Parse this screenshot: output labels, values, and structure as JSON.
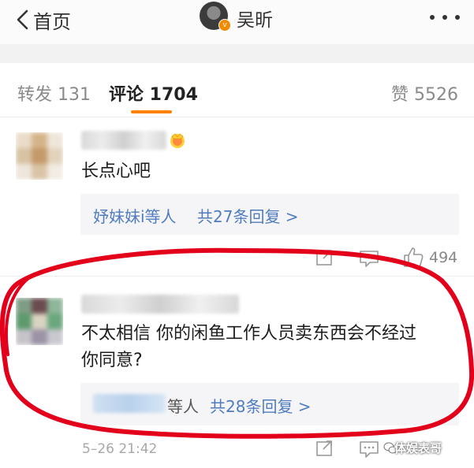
{
  "header": {
    "back_label": "首页",
    "title": "吴昕",
    "verified_badge": "v"
  },
  "tabs": [
    {
      "label": "转发 131"
    },
    {
      "label": "评论 1704"
    },
    {
      "label": "赞 5526"
    }
  ],
  "comments": [
    {
      "text": "长点心吧",
      "reply_prefix": "妤妹妹i等人",
      "reply_count": "共27条回复 >",
      "like_count": "494"
    },
    {
      "text_line1": "不太相信 你的闲鱼工作人员卖东西会不经过",
      "text_line2": "你同意?",
      "reply_suffix": "等人",
      "reply_count": "共28条回复 >",
      "time": "5–26 21:42"
    }
  ],
  "watermark": "体娱表哥",
  "colors": {
    "accent": "#ff8200",
    "link": "#4f7cbe",
    "annotation_ring": "#e3001b"
  }
}
